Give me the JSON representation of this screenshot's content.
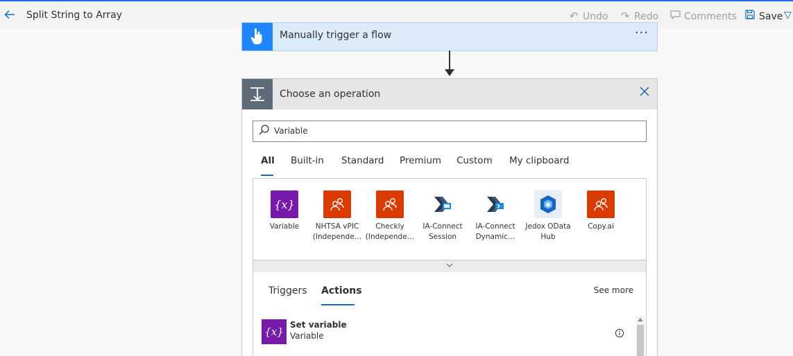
{
  "header": {
    "title": "Split String to Array",
    "commands": {
      "undo": "Undo",
      "redo": "Redo",
      "comments": "Comments",
      "save": "Save"
    }
  },
  "trigger": {
    "title": "Manually trigger a flow",
    "menu": "···",
    "icon": "touch-hand-icon",
    "color": "#1f85ff"
  },
  "operation": {
    "title": "Choose an operation",
    "icon": "operation-icon",
    "search_value": "Variable",
    "tabs": [
      "All",
      "Built-in",
      "Standard",
      "Premium",
      "Custom",
      "My clipboard"
    ],
    "active_tab": "All",
    "connectors": [
      {
        "label": "Variable",
        "color": "#7719aa",
        "icon": "variable-icon"
      },
      {
        "label": "NHTSA vPIC (Independe…",
        "color": "#da3b01",
        "icon": "people-icon"
      },
      {
        "label": "Checkly (Independe…",
        "color": "#da3b01",
        "icon": "people-icon"
      },
      {
        "label": "IA-Connect Session",
        "color": "#ffffff",
        "icon": "ia-connect-session-icon"
      },
      {
        "label": "IA-Connect Dynamic…",
        "color": "#ffffff",
        "icon": "ia-connect-dynamic-icon"
      },
      {
        "label": "Jedox OData Hub",
        "color": "#e8eef6",
        "icon": "jedox-icon"
      },
      {
        "label": "Copy.ai",
        "color": "#da3b01",
        "icon": "people-icon"
      }
    ],
    "subtabs": {
      "triggers": "Triggers",
      "actions": "Actions",
      "active": "Actions"
    },
    "see_more": "See more",
    "actions": [
      {
        "name": "Set variable",
        "connector": "Variable",
        "icon": "variable-icon"
      }
    ]
  },
  "colors": {
    "accent": "#0f6cbd",
    "variable_purple": "#7719aa",
    "connector_orange": "#da3b01",
    "operation_gray": "#5e6a77"
  }
}
